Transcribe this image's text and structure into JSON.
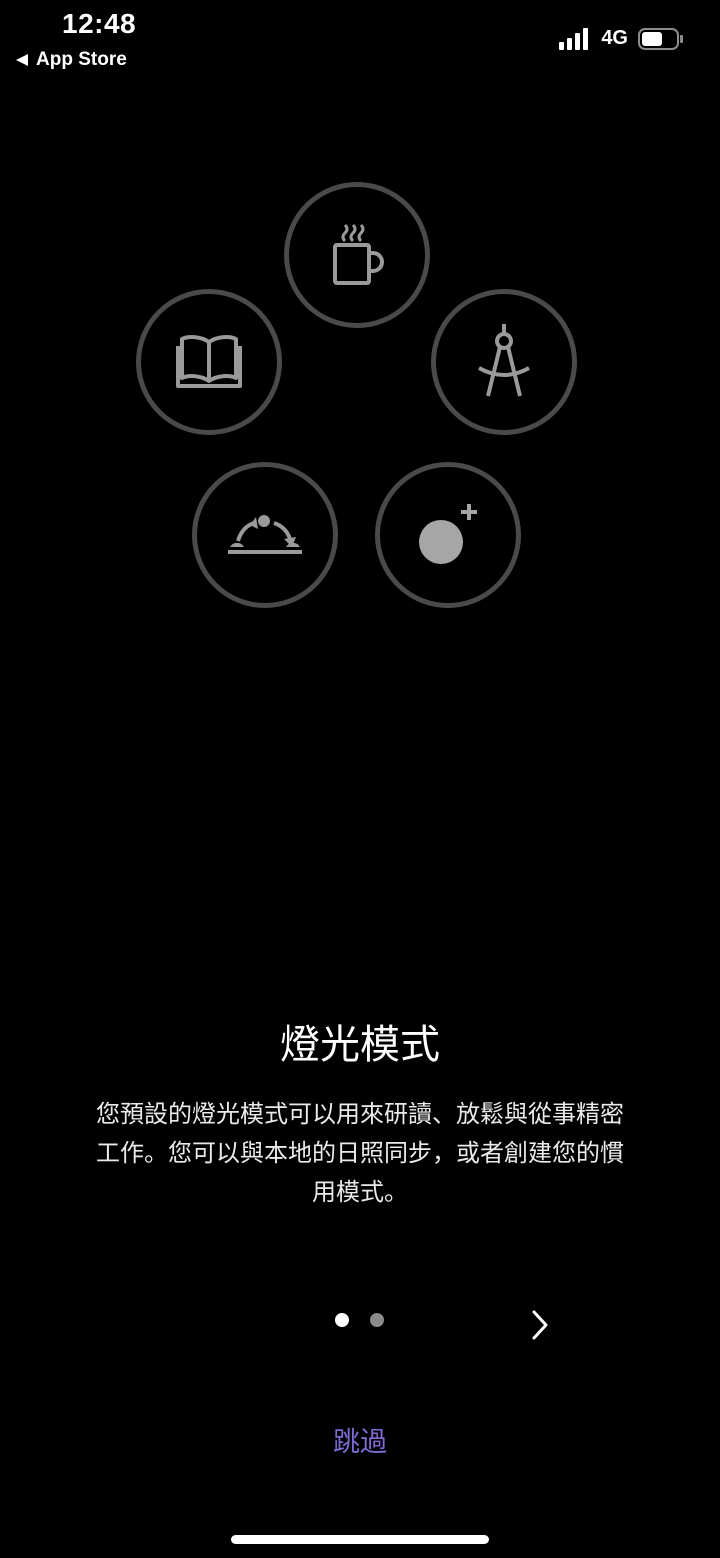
{
  "status_bar": {
    "time": "12:48",
    "back_label": "App Store",
    "network": "4G"
  },
  "modes": [
    {
      "icon": "coffee-cup-icon"
    },
    {
      "icon": "open-book-icon"
    },
    {
      "icon": "drafting-compass-icon"
    },
    {
      "icon": "sunrise-sunset-icon"
    },
    {
      "icon": "add-custom-light-icon"
    }
  ],
  "content": {
    "title": "燈光模式",
    "description": "您預設的燈光模式可以用來研讀、放鬆與從事精密工作。您可以與本地的日照同步，或者創建您的慣用模式。"
  },
  "pager": {
    "current_page": 1,
    "page_count": 2
  },
  "skip_label": "跳過",
  "colors": {
    "background": "#000000",
    "circle_border": "#4a4a4a",
    "icon": "#9a9a9a",
    "accent": "#7f6ad3"
  }
}
